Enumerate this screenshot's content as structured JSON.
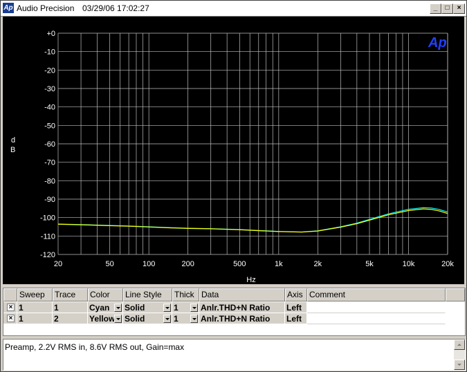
{
  "window": {
    "app_icon": "Ap",
    "title": "Audio Precision",
    "datetime": "03/29/06 17:02:27",
    "controls": {
      "minimize": "_",
      "maximize": "□",
      "close": "×"
    }
  },
  "chart_data": {
    "type": "line",
    "logo": "Ap",
    "ylabel": "d\nB",
    "ylabel_lines": [
      "d",
      "B"
    ],
    "xlabel": "Hz",
    "x_scale": "log",
    "xlim": [
      20,
      20000
    ],
    "ylim": [
      -120,
      0
    ],
    "grid": true,
    "background": "#000000",
    "grid_color": "#c0c0c0",
    "y_ticks": [
      "+0",
      "-10",
      "-20",
      "-30",
      "-40",
      "-50",
      "-60",
      "-70",
      "-80",
      "-90",
      "-100",
      "-110",
      "-120"
    ],
    "y_tick_values": [
      0,
      -10,
      -20,
      -30,
      -40,
      -50,
      -60,
      -70,
      -80,
      -90,
      -100,
      -110,
      -120
    ],
    "x_ticks": [
      "20",
      "50",
      "100",
      "200",
      "500",
      "1k",
      "2k",
      "5k",
      "10k",
      "20k"
    ],
    "x_tick_values": [
      20,
      50,
      100,
      200,
      500,
      1000,
      2000,
      5000,
      10000,
      20000
    ],
    "series": [
      {
        "color": "#00ffff",
        "x": [
          20,
          30,
          50,
          70,
          100,
          150,
          200,
          300,
          500,
          700,
          1000,
          1500,
          2000,
          3000,
          4000,
          5000,
          7000,
          10000,
          13000,
          15000,
          17000,
          20000
        ],
        "y": [
          -103.5,
          -103.8,
          -104.3,
          -104.6,
          -105,
          -105.5,
          -105.8,
          -106,
          -106.5,
          -107,
          -107.5,
          -107.8,
          -107.2,
          -105,
          -103,
          -101,
          -98,
          -95.5,
          -94.6,
          -94.8,
          -95.5,
          -97
        ]
      },
      {
        "color": "#ffff00",
        "x": [
          20,
          30,
          50,
          70,
          100,
          150,
          200,
          300,
          500,
          700,
          1000,
          1500,
          2000,
          3000,
          4000,
          5000,
          7000,
          10000,
          13000,
          15000,
          17000,
          20000
        ],
        "y": [
          -103.6,
          -103.9,
          -104.4,
          -104.7,
          -105.1,
          -105.6,
          -105.9,
          -106.1,
          -106.6,
          -107.1,
          -107.6,
          -107.9,
          -107.3,
          -105.2,
          -103.3,
          -101.4,
          -98.5,
          -96.2,
          -95.3,
          -95.6,
          -96.3,
          -97.8
        ]
      }
    ]
  },
  "table": {
    "columns": [
      "Sweep",
      "Trace",
      "Color",
      "Line Style",
      "Thick",
      "Data",
      "Axis",
      "Comment"
    ],
    "rows": [
      {
        "checked": "×",
        "sweep": "1",
        "trace": "1",
        "color": "Cyan",
        "line_style": "Solid",
        "thick": "1",
        "data": "Anlr.THD+N Ratio",
        "axis": "Left",
        "comment": ""
      },
      {
        "checked": "×",
        "sweep": "1",
        "trace": "2",
        "color": "Yellow",
        "line_style": "Solid",
        "thick": "1",
        "data": "Anlr.THD+N Ratio",
        "axis": "Left",
        "comment": ""
      }
    ]
  },
  "comment_box": {
    "text": "Preamp, 2.2V RMS in, 8.6V RMS out, Gain=max"
  }
}
